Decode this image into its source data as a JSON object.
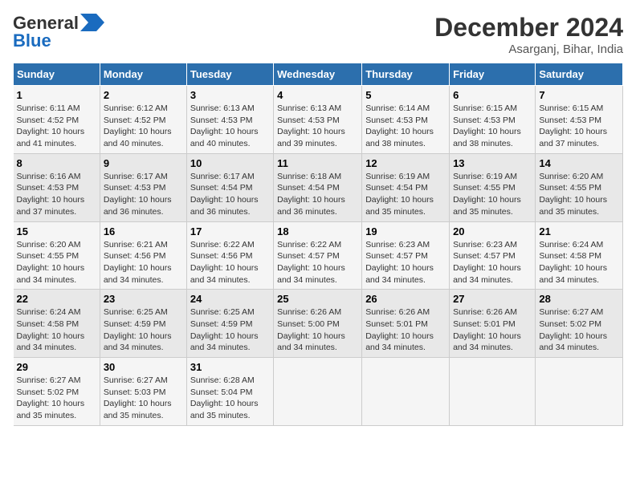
{
  "logo": {
    "part1": "General",
    "part2": "Blue"
  },
  "header": {
    "month": "December 2024",
    "location": "Asarganj, Bihar, India"
  },
  "weekdays": [
    "Sunday",
    "Monday",
    "Tuesday",
    "Wednesday",
    "Thursday",
    "Friday",
    "Saturday"
  ],
  "weeks": [
    [
      {
        "day": "1",
        "sunrise": "6:11 AM",
        "sunset": "4:52 PM",
        "daylight": "10 hours and 41 minutes."
      },
      {
        "day": "2",
        "sunrise": "6:12 AM",
        "sunset": "4:52 PM",
        "daylight": "10 hours and 40 minutes."
      },
      {
        "day": "3",
        "sunrise": "6:13 AM",
        "sunset": "4:53 PM",
        "daylight": "10 hours and 40 minutes."
      },
      {
        "day": "4",
        "sunrise": "6:13 AM",
        "sunset": "4:53 PM",
        "daylight": "10 hours and 39 minutes."
      },
      {
        "day": "5",
        "sunrise": "6:14 AM",
        "sunset": "4:53 PM",
        "daylight": "10 hours and 38 minutes."
      },
      {
        "day": "6",
        "sunrise": "6:15 AM",
        "sunset": "4:53 PM",
        "daylight": "10 hours and 38 minutes."
      },
      {
        "day": "7",
        "sunrise": "6:15 AM",
        "sunset": "4:53 PM",
        "daylight": "10 hours and 37 minutes."
      }
    ],
    [
      {
        "day": "8",
        "sunrise": "6:16 AM",
        "sunset": "4:53 PM",
        "daylight": "10 hours and 37 minutes."
      },
      {
        "day": "9",
        "sunrise": "6:17 AM",
        "sunset": "4:53 PM",
        "daylight": "10 hours and 36 minutes."
      },
      {
        "day": "10",
        "sunrise": "6:17 AM",
        "sunset": "4:54 PM",
        "daylight": "10 hours and 36 minutes."
      },
      {
        "day": "11",
        "sunrise": "6:18 AM",
        "sunset": "4:54 PM",
        "daylight": "10 hours and 36 minutes."
      },
      {
        "day": "12",
        "sunrise": "6:19 AM",
        "sunset": "4:54 PM",
        "daylight": "10 hours and 35 minutes."
      },
      {
        "day": "13",
        "sunrise": "6:19 AM",
        "sunset": "4:55 PM",
        "daylight": "10 hours and 35 minutes."
      },
      {
        "day": "14",
        "sunrise": "6:20 AM",
        "sunset": "4:55 PM",
        "daylight": "10 hours and 35 minutes."
      }
    ],
    [
      {
        "day": "15",
        "sunrise": "6:20 AM",
        "sunset": "4:55 PM",
        "daylight": "10 hours and 34 minutes."
      },
      {
        "day": "16",
        "sunrise": "6:21 AM",
        "sunset": "4:56 PM",
        "daylight": "10 hours and 34 minutes."
      },
      {
        "day": "17",
        "sunrise": "6:22 AM",
        "sunset": "4:56 PM",
        "daylight": "10 hours and 34 minutes."
      },
      {
        "day": "18",
        "sunrise": "6:22 AM",
        "sunset": "4:57 PM",
        "daylight": "10 hours and 34 minutes."
      },
      {
        "day": "19",
        "sunrise": "6:23 AM",
        "sunset": "4:57 PM",
        "daylight": "10 hours and 34 minutes."
      },
      {
        "day": "20",
        "sunrise": "6:23 AM",
        "sunset": "4:57 PM",
        "daylight": "10 hours and 34 minutes."
      },
      {
        "day": "21",
        "sunrise": "6:24 AM",
        "sunset": "4:58 PM",
        "daylight": "10 hours and 34 minutes."
      }
    ],
    [
      {
        "day": "22",
        "sunrise": "6:24 AM",
        "sunset": "4:58 PM",
        "daylight": "10 hours and 34 minutes."
      },
      {
        "day": "23",
        "sunrise": "6:25 AM",
        "sunset": "4:59 PM",
        "daylight": "10 hours and 34 minutes."
      },
      {
        "day": "24",
        "sunrise": "6:25 AM",
        "sunset": "4:59 PM",
        "daylight": "10 hours and 34 minutes."
      },
      {
        "day": "25",
        "sunrise": "6:26 AM",
        "sunset": "5:00 PM",
        "daylight": "10 hours and 34 minutes."
      },
      {
        "day": "26",
        "sunrise": "6:26 AM",
        "sunset": "5:01 PM",
        "daylight": "10 hours and 34 minutes."
      },
      {
        "day": "27",
        "sunrise": "6:26 AM",
        "sunset": "5:01 PM",
        "daylight": "10 hours and 34 minutes."
      },
      {
        "day": "28",
        "sunrise": "6:27 AM",
        "sunset": "5:02 PM",
        "daylight": "10 hours and 34 minutes."
      }
    ],
    [
      {
        "day": "29",
        "sunrise": "6:27 AM",
        "sunset": "5:02 PM",
        "daylight": "10 hours and 35 minutes."
      },
      {
        "day": "30",
        "sunrise": "6:27 AM",
        "sunset": "5:03 PM",
        "daylight": "10 hours and 35 minutes."
      },
      {
        "day": "31",
        "sunrise": "6:28 AM",
        "sunset": "5:04 PM",
        "daylight": "10 hours and 35 minutes."
      },
      null,
      null,
      null,
      null
    ]
  ],
  "labels": {
    "sunrise": "Sunrise:",
    "sunset": "Sunset:",
    "daylight": "Daylight:"
  }
}
